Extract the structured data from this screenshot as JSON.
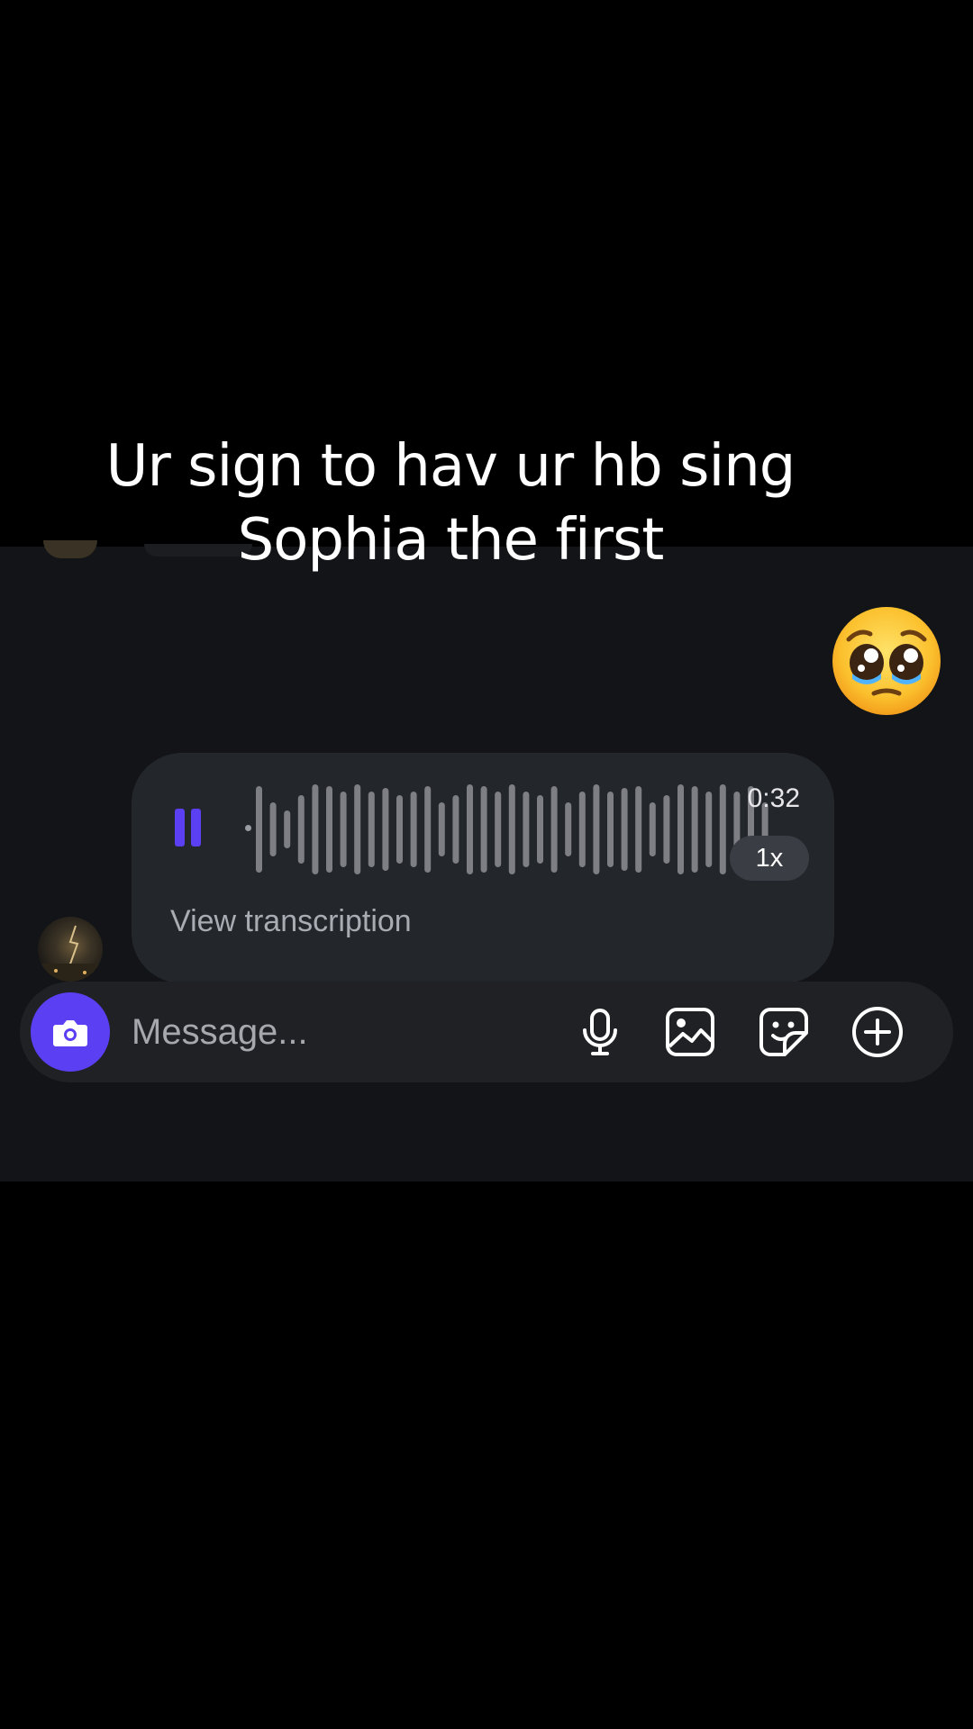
{
  "caption": {
    "line1": "Ur sign to hav ur hb sing",
    "line2": "Sophia the first"
  },
  "reaction": {
    "emoji": "pleading-face-emoji"
  },
  "voice_message": {
    "duration": "0:32",
    "speed": "1x",
    "transcription_label": "View transcription",
    "state": "playing",
    "progress": 0.0,
    "accent_color": "#5b3ff2"
  },
  "composer": {
    "placeholder": "Message...",
    "icons": [
      "camera-icon",
      "microphone-icon",
      "gallery-icon",
      "sticker-icon",
      "add-icon"
    ]
  }
}
